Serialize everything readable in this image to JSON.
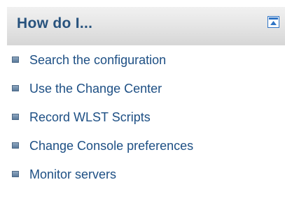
{
  "panel": {
    "title": "How do I...",
    "collapse_icon": "collapse-panel-icon"
  },
  "links": [
    {
      "label": "Search the configuration"
    },
    {
      "label": "Use the Change Center"
    },
    {
      "label": "Record WLST Scripts"
    },
    {
      "label": "Change Console preferences"
    },
    {
      "label": "Monitor servers"
    }
  ],
  "colors": {
    "title": "#27527d",
    "link": "#1d4f84",
    "header_gradient_top": "#f1f1f1",
    "header_gradient_bottom": "#d6d6d6",
    "icon_border": "#2f74c5",
    "bullet": "#5a7a9b"
  }
}
